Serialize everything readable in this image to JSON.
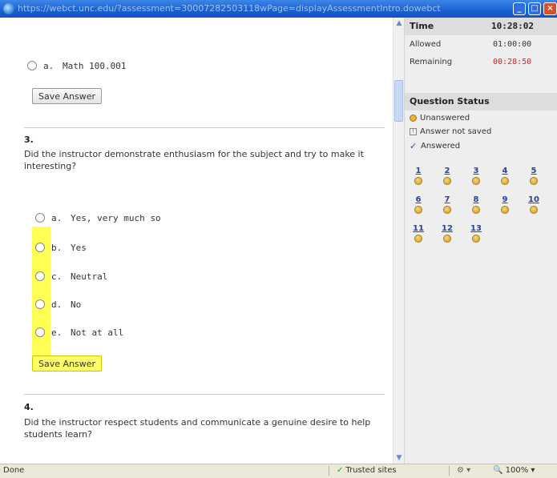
{
  "window": {
    "url": "https://webct.unc.edu/?assessment=30007282503118wPage=displayAssessmentIntro.dowebct",
    "min_glyph": "_",
    "max_glyph": "□",
    "close_glyph": "×"
  },
  "content": {
    "prev_option": {
      "letter": "a.",
      "text": "Math 100.001"
    },
    "save_label_1": "Save Answer",
    "q3": {
      "number": "3.",
      "text": "Did the instructor demonstrate enthusiasm for the subject and try to make it interesting?",
      "options": [
        {
          "letter": "a.",
          "text": "Yes, very much so"
        },
        {
          "letter": "b.",
          "text": "Yes"
        },
        {
          "letter": "c.",
          "text": "Neutral"
        },
        {
          "letter": "d.",
          "text": "No"
        },
        {
          "letter": "e.",
          "text": "Not at all"
        }
      ],
      "save_label": "Save Answer"
    },
    "q4": {
      "number": "4.",
      "text": "Did the instructor respect students and communicate a genuine desire to help students learn?"
    }
  },
  "panel": {
    "time_label": "Time",
    "clock": "10:28:02",
    "allowed_label": "Allowed",
    "allowed_value": "01:00:00",
    "remaining_label": "Remaining",
    "remaining_value": "00:28:50",
    "qs_title": "Question Status",
    "legend": {
      "unanswered": "Unanswered",
      "not_saved": "Answer not saved",
      "answered": "Answered"
    },
    "questions": [
      "1",
      "2",
      "3",
      "4",
      "5",
      "6",
      "7",
      "8",
      "9",
      "10",
      "11",
      "12",
      "13"
    ]
  },
  "statusbar": {
    "done": "Done",
    "trusted": "Trusted sites",
    "zoom": "100%"
  },
  "colors": {
    "highlight": "#ffff55",
    "remaining": "#e02020",
    "title_bar": "#1a5fd0",
    "link": "#2a40a0"
  }
}
